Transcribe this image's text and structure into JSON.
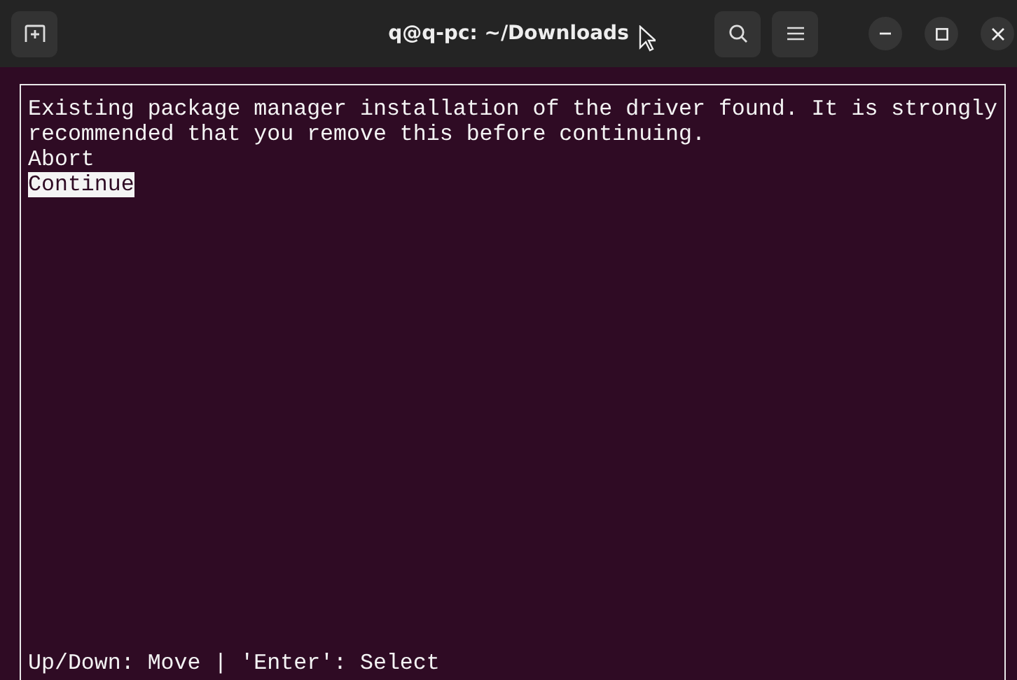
{
  "window": {
    "title": "q@q-pc: ~/Downloads"
  },
  "dialog": {
    "message": "Existing package manager installation of the driver found. It is strongly\nrecommended that you remove this before continuing.",
    "options": [
      {
        "label": "Abort",
        "selected": false
      },
      {
        "label": "Continue",
        "selected": true
      }
    ],
    "hint": "Up/Down: Move | 'Enter': Select"
  }
}
